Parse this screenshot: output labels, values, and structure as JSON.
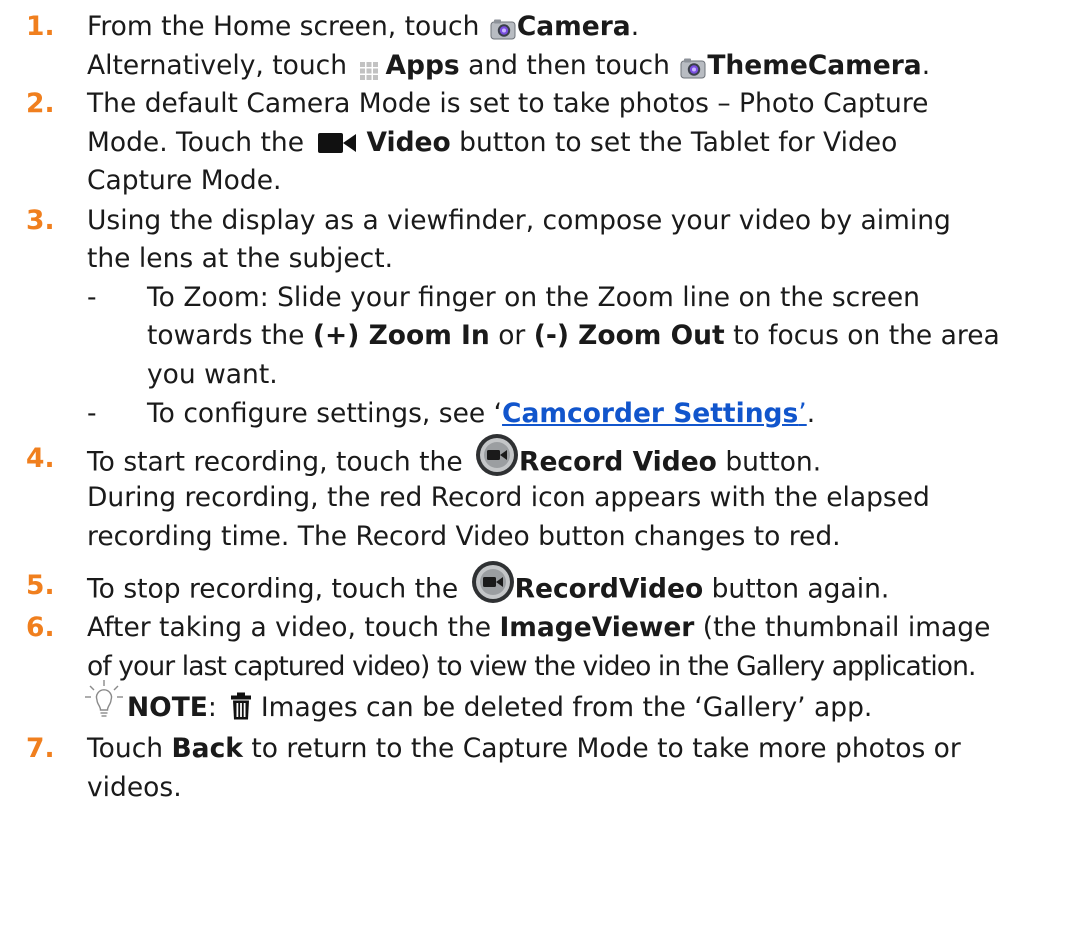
{
  "colors": {
    "step_number": "#f07f1e",
    "link": "#1155cc",
    "text": "#1a1a1a"
  },
  "steps": [
    {
      "number": "1.",
      "a": "From the Home screen, touch ",
      "camera_icon": "camera-icon",
      "camera": "Camera",
      "period": ".",
      "alt_a": "Alternatively, touch ",
      "apps_icon": "apps-grid-icon",
      "apps": "Apps",
      "alt_b": " and then touch ",
      "themecamera": "ThemeCamera",
      "alt_c": "."
    },
    {
      "number": "2.",
      "line1": "The default Camera Mode is set to take photos – Photo Capture",
      "l2a": "Mode. Touch the ",
      "video_icon": "video-camera-icon",
      "video": "Video",
      "l2b": " button to set the Tablet for Video",
      "line3": "Capture Mode."
    },
    {
      "number": "3.",
      "line1": "Using the display as a viewfinder, compose your video by aiming",
      "line2": "the lens at the subject.",
      "bullets": [
        {
          "dash": "-",
          "l1": "To Zoom: Slide your finger on the Zoom line on the screen",
          "l2a": "towards the ",
          "zoom_in": "(+) Zoom In",
          "l2b": " or ",
          "zoom_out": "(-) Zoom Out",
          "l2c": " to focus on the area",
          "l3": "you want."
        },
        {
          "dash": "-",
          "a": "To configure settings, see ‘",
          "link": "Camcorder Settings",
          "b": "’",
          "c": "."
        }
      ]
    },
    {
      "number": "4.",
      "a": "To start recording, touch the ",
      "record_icon": "record-video-button-icon",
      "record": "Record Video",
      "b": " button.",
      "line2": "During recording, the red Record icon appears with the elapsed",
      "line3": "recording time. The Record Video button changes to red."
    },
    {
      "number": "5.",
      "a": "To stop recording, touch the ",
      "record_icon": "record-video-button-icon",
      "record": "RecordVideo",
      "b": " button again."
    },
    {
      "number": "6.",
      "a": "After taking a video, touch the ",
      "imageviewer": "ImageViewer",
      "b": " (the thumbnail image",
      "line2": "of your last captured video) to view the video in the Gallery application."
    },
    {
      "number": "7.",
      "a": "Touch ",
      "back": "Back",
      "b": " to return to the Capture Mode to take more photos or",
      "line2": "videos."
    }
  ],
  "note": {
    "bulb_icon": "lightbulb-icon",
    "label": "NOTE",
    "colon": ":",
    "trash_icon": "trash-icon",
    "text": "Images can be deleted from the ‘Gallery’ app."
  }
}
